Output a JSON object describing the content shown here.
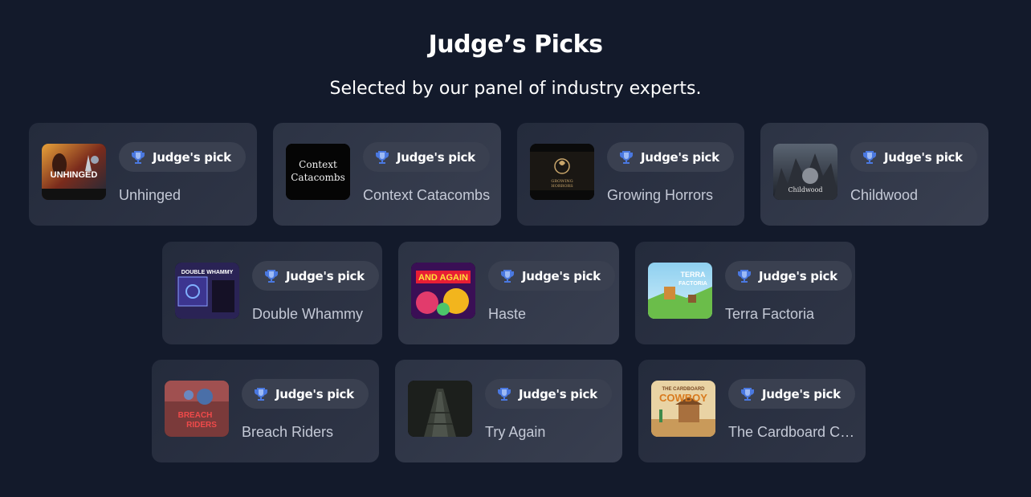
{
  "header": {
    "title": "Judge’s Picks",
    "subtitle": "Selected by our panel of industry experts."
  },
  "badge_icon": "trophy-icon",
  "badge_label": "Judge's pick",
  "games": [
    {
      "name": "Unhinged",
      "thumb_text": "UNHINGED"
    },
    {
      "name": "Context Catacombs",
      "thumb_text": "Context Catacombs"
    },
    {
      "name": "Growing Horrors",
      "thumb_text": "GROWING HORRORS"
    },
    {
      "name": "Childwood",
      "thumb_text": "Childwood"
    },
    {
      "name": "Double Whammy",
      "thumb_text": "DOUBLE WHAMMY"
    },
    {
      "name": "Haste",
      "thumb_text": "AND AGAIN"
    },
    {
      "name": "Terra Factoria",
      "thumb_text": "TERRA FACTORIA"
    },
    {
      "name": "Breach Riders",
      "thumb_text": "BREACH RIDERS"
    },
    {
      "name": "Try Again",
      "thumb_text": ""
    },
    {
      "name": "The Cardboard Cowboy",
      "thumb_text": "THE CARDBOARD COWBOY"
    }
  ],
  "colors": {
    "background": "#131a2b",
    "card": "#2a3042",
    "badge": "#3a4050",
    "trophy": "#4a78e0",
    "name_text": "#c4c9d6"
  }
}
